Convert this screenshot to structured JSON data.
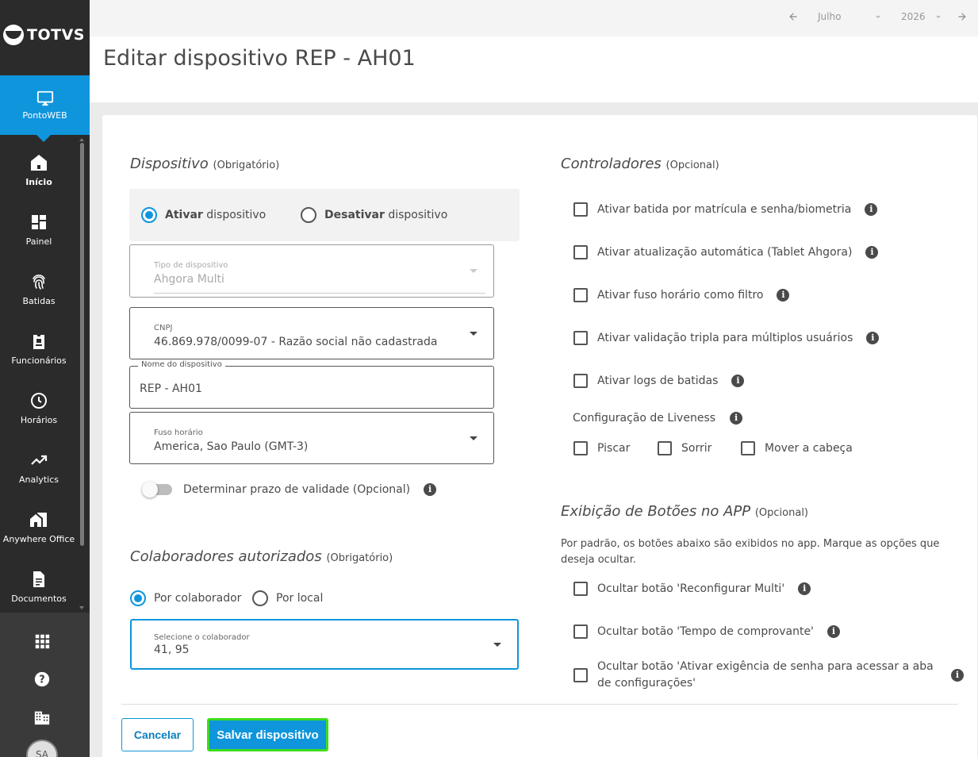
{
  "brand": {
    "name": "TOTVS",
    "accent": "#0e95dc",
    "save_outline": "#3ddc1b"
  },
  "sidebar": {
    "app": {
      "label": "PontoWEB",
      "icon": "monitor-icon"
    },
    "items": [
      {
        "label": "Início",
        "icon": "home-icon",
        "active": true
      },
      {
        "label": "Painel",
        "icon": "dashboard-icon"
      },
      {
        "label": "Batidas",
        "icon": "fingerprint-icon"
      },
      {
        "label": "Funcionários",
        "icon": "badge-icon"
      },
      {
        "label": "Horários",
        "icon": "clock-icon"
      },
      {
        "label": "Analytics",
        "icon": "trending-up-icon"
      },
      {
        "label": "Anywhere Office",
        "icon": "home-work-icon"
      },
      {
        "label": "Documentos",
        "icon": "document-icon"
      }
    ],
    "bottom_icons": [
      "apps-grid-icon",
      "help-icon",
      "building-icon"
    ],
    "avatar": "SA"
  },
  "topbar": {
    "month": "Julho",
    "year": "2026"
  },
  "page": {
    "title": "Editar dispositivo REP - AH01"
  },
  "device": {
    "title": "Dispositivo",
    "optional": "(Obrigatório)",
    "activate": {
      "bold": "Ativar",
      "rest": " dispositivo"
    },
    "deactivate": {
      "bold": "Desativar",
      "rest": " dispositivo"
    },
    "type": {
      "label": "Tipo de dispositivo",
      "value": "Ahgora Multi"
    },
    "cnpj": {
      "label": "CNPJ",
      "value": "46.869.978/0099-07 - Razão social não cadastrada"
    },
    "name": {
      "label": "Nome do dispositivo",
      "value": "REP - AH01"
    },
    "timezone": {
      "label": "Fuso horário",
      "value": "America, Sao Paulo (GMT-3)"
    },
    "validity_toggle": "Determinar prazo de validade (Opcional)"
  },
  "collaborators": {
    "title": "Colaboradores autorizados",
    "optional": "(Obrigatório)",
    "by_collaborator": "Por colaborador",
    "by_location": "Por local",
    "select": {
      "label": "Selecione o colaborador",
      "value": "41, 95"
    }
  },
  "controllers": {
    "title": "Controladores",
    "optional": "(Opcional)",
    "options": [
      "Ativar batida por matrícula e senha/biometria",
      "Ativar atualização automática (Tablet Ahgora)",
      "Ativar fuso horário como filtro",
      "Ativar validação tripla para múltiplos usuários",
      "Ativar logs de batidas"
    ],
    "liveness": {
      "label": "Configuração de Liveness",
      "options": [
        "Piscar",
        "Sorrir",
        "Mover a cabeça"
      ]
    }
  },
  "app_buttons": {
    "title": "Exibição de Botões no APP",
    "optional": "(Opcional)",
    "description": "Por padrão, os botões abaixo são exibidos no app. Marque as opções que deseja ocultar.",
    "options": [
      "Ocultar botão 'Reconfigurar Multi'",
      "Ocultar botão 'Tempo de comprovante'",
      "Ocultar botão 'Ativar exigência de senha para acessar a aba de configurações'"
    ]
  },
  "actions": {
    "cancel": "Cancelar",
    "save": "Salvar dispositivo"
  }
}
